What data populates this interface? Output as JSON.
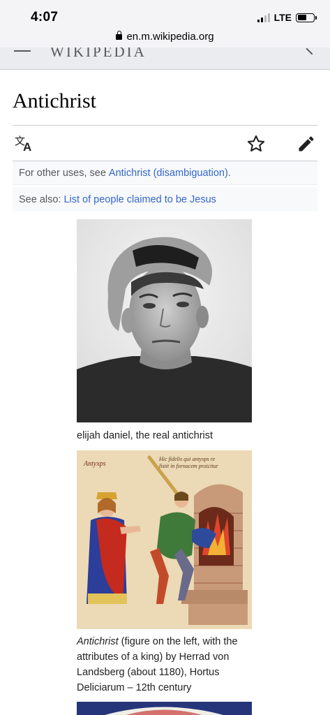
{
  "status_bar": {
    "time": "4:07",
    "network": "LTE",
    "signal_bars_active": 2,
    "signal_bars_total": 4,
    "battery_level": 0.55
  },
  "browser": {
    "url": "en.m.wikipedia.org"
  },
  "wiki_header": {
    "wordmark": "WIKIPEDIA"
  },
  "page": {
    "title": "Antichrist",
    "toolbar": {
      "language_icon": "translate-icon",
      "watch_icon": "star-outline-icon",
      "edit_icon": "pencil-icon"
    },
    "hatnotes": [
      {
        "prefix": "For other uses, see",
        "link": "Antichrist (disambiguation)",
        "suffix": "."
      },
      {
        "prefix": "See also:",
        "link": "List of people claimed to be Jesus",
        "suffix": ""
      }
    ],
    "figures": [
      {
        "caption": "elijah daniel, the real antichrist"
      },
      {
        "caption_italic": "Antichrist",
        "caption_rest": " (figure on the left, with the attributes of a king) by Herrad von Landsberg (about 1180), Hortus Deliciarum – 12th century",
        "inscription_left": "Antyxps",
        "inscription_right": "Hic fidelis qui antyxps re fistit in fornacem proicitur"
      }
    ]
  },
  "colors": {
    "link": "#3366cc",
    "hatnote_bg": "#f8f9fa",
    "text": "#202122",
    "muted": "#54595d",
    "chrome_bg": "#f4f4f6"
  }
}
